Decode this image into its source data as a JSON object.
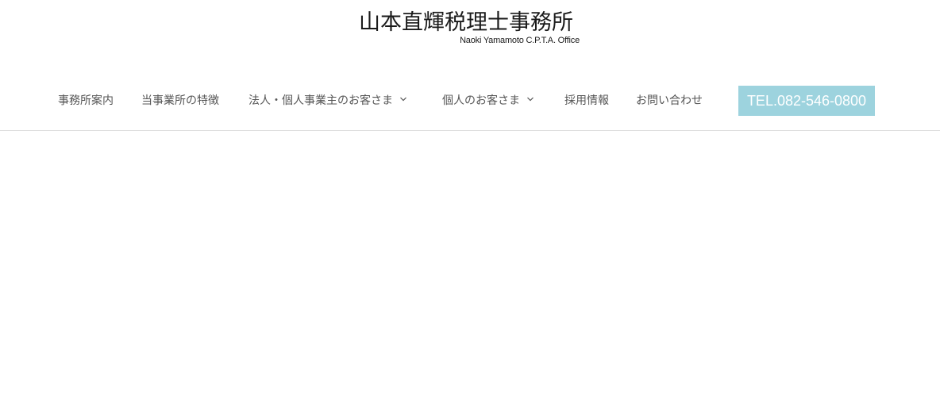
{
  "logo": {
    "main": "山本直輝税理士事務所",
    "sub": "Naoki Yamamoto C.P.T.A. Office"
  },
  "nav": {
    "items": [
      {
        "label": "事務所案内",
        "has_dropdown": false
      },
      {
        "label": "当事業所の特徴",
        "has_dropdown": false
      },
      {
        "label": "法人・個人事業主のお客さま",
        "has_dropdown": true
      },
      {
        "label": "個人のお客さま",
        "has_dropdown": true
      },
      {
        "label": "採用情報",
        "has_dropdown": false
      },
      {
        "label": "お問い合わせ",
        "has_dropdown": false
      }
    ],
    "tel_button": "TEL.082-546-0800"
  },
  "colors": {
    "tel_background": "#9dd3de",
    "nav_text": "#555555",
    "logo_text": "#1a1a1a"
  }
}
